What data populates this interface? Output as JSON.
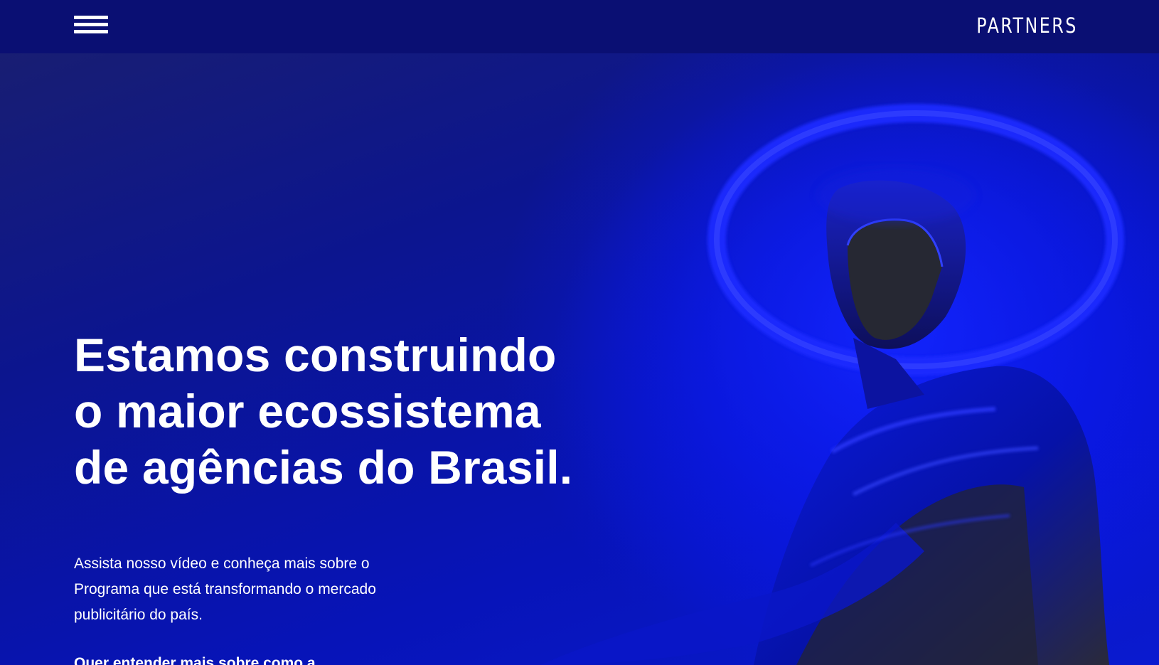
{
  "header": {
    "brand": "PARTNERS",
    "menu_icon": "hamburger-menu-icon"
  },
  "hero": {
    "headline_lines": [
      "Estamos construindo",
      "o maior ecossistema",
      "de agências do Brasil."
    ],
    "intro": "Assista nosso vídeo e conheça mais sobre o Programa que está transformando o mercado publicitário do país.",
    "cta_text": "Quer entender mais sobre como a"
  },
  "colors": {
    "header_bg": "#0a0f73",
    "hero_bg": "#0c158f",
    "accent_blue": "#0a18e8",
    "text": "#ffffff"
  }
}
